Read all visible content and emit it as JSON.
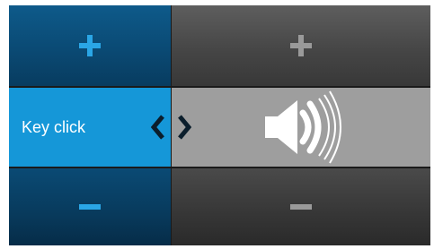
{
  "setting": {
    "label": "Key click",
    "increase_icon": "plus-icon",
    "decrease_icon": "minus-icon",
    "value_icon": "speaker-volume-high-icon",
    "prev_icon": "chevron-left-icon",
    "next_icon": "chevron-right-icon"
  },
  "colors": {
    "accent": "#1597d8",
    "left_dark": "#0a4a74",
    "right_dark": "#464646",
    "right_selected": "#9e9e9e",
    "plus_blue": "#2aa6e6",
    "plus_gray": "#9a9a9a"
  }
}
